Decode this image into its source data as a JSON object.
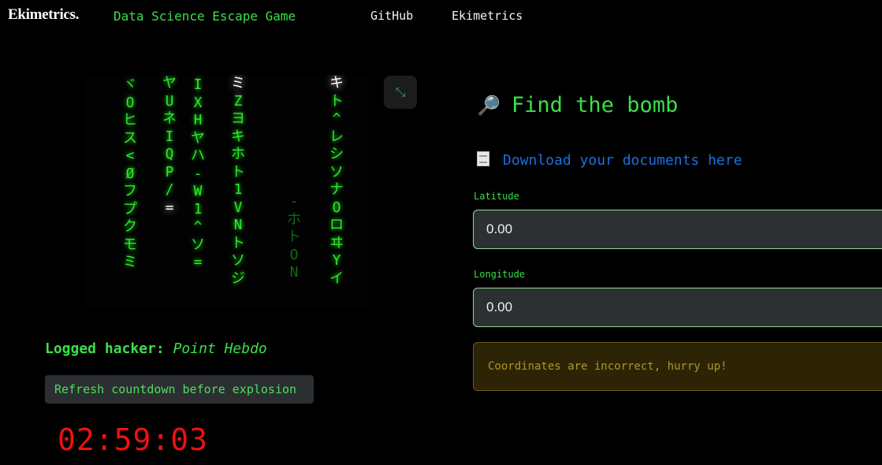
{
  "header": {
    "brand": "Ekimetrics.",
    "app_title": "Data Science Escape Game",
    "nav": [
      "GitHub",
      "Ekimetrics"
    ]
  },
  "matrix": {
    "expand_icon": "expand-icon",
    "columns": [
      {
        "chars": [
          "ヾ",
          "O",
          "ヒ",
          "ス",
          "<",
          "Ø",
          "フ",
          "プ",
          "ク",
          "モ",
          "ミ"
        ],
        "head": -1
      },
      {
        "chars": [
          "ヤ",
          "U",
          "ネ",
          "I",
          "Q",
          "P",
          "/",
          "="
        ],
        "head": 7
      },
      {
        "chars": [
          "I",
          "X",
          "H",
          "ヤ",
          "ハ",
          "-",
          "W",
          "1",
          "^",
          "ソ",
          "="
        ],
        "head": -1
      },
      {
        "chars": [
          "ミ",
          "Z",
          "ヨ",
          "キ",
          "ホ",
          "ト",
          "1",
          "V",
          "N",
          "ト",
          "ソ",
          "ジ"
        ],
        "head": 0
      },
      {
        "chars": [
          "-",
          "ホ",
          "ト",
          "O",
          "N"
        ],
        "head": -1,
        "dim": true
      },
      {
        "chars": [
          "キ",
          "ト",
          "^",
          "レ",
          "シ",
          "ソ",
          "ナ",
          "O",
          "ロ",
          "ヰ",
          "Y",
          "イ"
        ],
        "head": 0
      }
    ]
  },
  "status": {
    "hacker_label": "Logged hacker:",
    "hacker_name": "Point Hebdo",
    "refresh_label": "Refresh countdown before explosion",
    "countdown": "02:59:03"
  },
  "mission": {
    "title_icon": "magnifier-icon",
    "title": "Find the bomb",
    "download_icon": "document-icon",
    "download_text": "Download your documents here",
    "latitude_label": "Latitude",
    "latitude_value": "0.00",
    "longitude_label": "Longitude",
    "longitude_value": "0.00",
    "alert": "Coordinates are incorrect, hurry up!"
  },
  "colors": {
    "accent_green": "#39e04a",
    "countdown_red": "#ee1111",
    "link_blue": "#1c6fe0",
    "warning_text": "#b09626"
  }
}
